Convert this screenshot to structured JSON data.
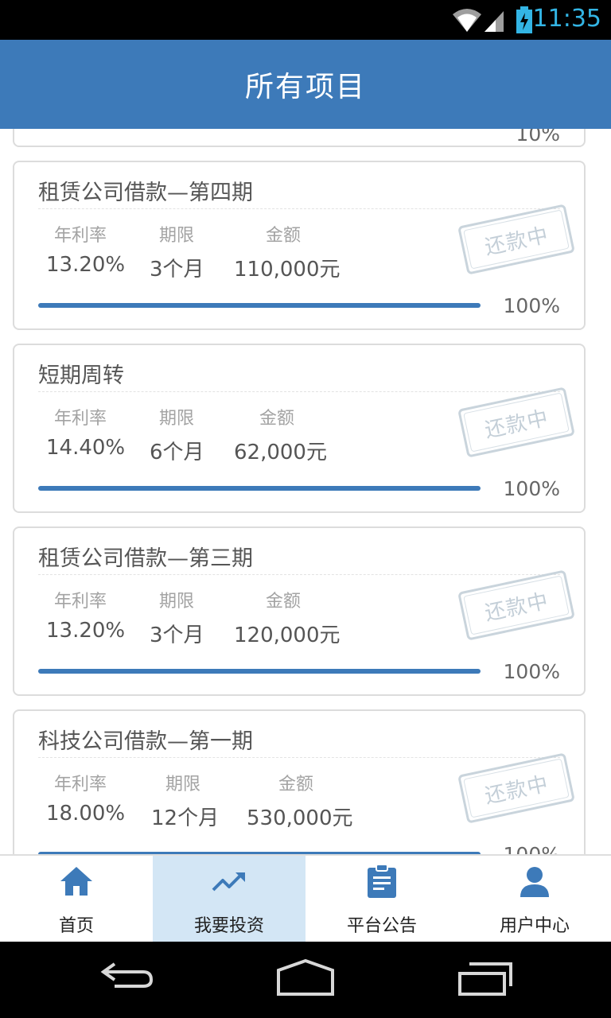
{
  "status_bar": {
    "time": "11:35"
  },
  "header": {
    "title": "所有项目"
  },
  "partial_top_card": {
    "progress_text": "10%"
  },
  "labels": {
    "rate": "年利率",
    "term": "期限",
    "amount": "金额",
    "stamp": "还款中"
  },
  "projects": [
    {
      "title": "租赁公司借款—第四期",
      "rate": "13.20%",
      "term": "3个月",
      "amount": "110,000元",
      "progress_text": "100%",
      "progress": 1.0
    },
    {
      "title": "短期周转",
      "rate": "14.40%",
      "term": "6个月",
      "amount": "62,000元",
      "progress_text": "100%",
      "progress": 1.0
    },
    {
      "title": "租赁公司借款—第三期",
      "rate": "13.20%",
      "term": "3个月",
      "amount": "120,000元",
      "progress_text": "100%",
      "progress": 1.0
    },
    {
      "title": "科技公司借款—第一期",
      "rate": "18.00%",
      "term": "12个月",
      "amount": "530,000元",
      "progress_text": "100%",
      "progress": 1.0
    }
  ],
  "bottom_nav": [
    {
      "label": "首页",
      "icon": "home-icon"
    },
    {
      "label": "我要投资",
      "icon": "trending-up-icon",
      "active": true
    },
    {
      "label": "平台公告",
      "icon": "clipboard-icon"
    },
    {
      "label": "用户中心",
      "icon": "user-icon"
    }
  ],
  "colors": {
    "brand": "#3d7ab9",
    "active_tab": "#d3e6f5",
    "status_accent": "#33b5e5"
  }
}
